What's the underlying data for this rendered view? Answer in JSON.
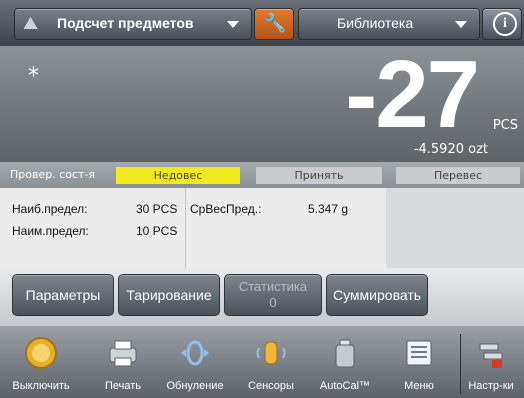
{
  "header": {
    "app_title": "Подсчет предметов",
    "library_label": "Библиотека"
  },
  "display": {
    "indicator": "*",
    "value": "-27",
    "unit": "PCS",
    "secondary": "-4.5920 ozt"
  },
  "check_bar": {
    "label": "Провер. сост-я",
    "under": "Недовес",
    "accept": "Принять",
    "over": "Перевес"
  },
  "stats": {
    "max_label": "Наиб.предел:",
    "max_value": "30 PCS",
    "min_label": "Наим.предел:",
    "min_value": "10 PCS",
    "apw_label": "СрВесПред.:",
    "apw_value": "5.347 g"
  },
  "softkeys": {
    "params": "Параметры",
    "tare": "Тарирование",
    "stats": "Статистика",
    "stats_count": "0",
    "accumulate": "Суммировать"
  },
  "bottom_bar": [
    {
      "label": "Выключить",
      "icon": "power-icon"
    },
    {
      "label": "Печать",
      "icon": "printer-icon"
    },
    {
      "label": "Обнуление",
      "icon": "zero-icon"
    },
    {
      "label": "Сенсоры",
      "icon": "hand-sensor-icon"
    },
    {
      "label": "AutoCal™",
      "icon": "calibration-weight-icon"
    },
    {
      "label": "Меню",
      "icon": "menu-icon"
    },
    {
      "label": "Настр-ки",
      "icon": "settings-icon"
    }
  ],
  "colors": {
    "under_highlight": "#f2ea1e",
    "wrench_accent": "#d26a24"
  }
}
